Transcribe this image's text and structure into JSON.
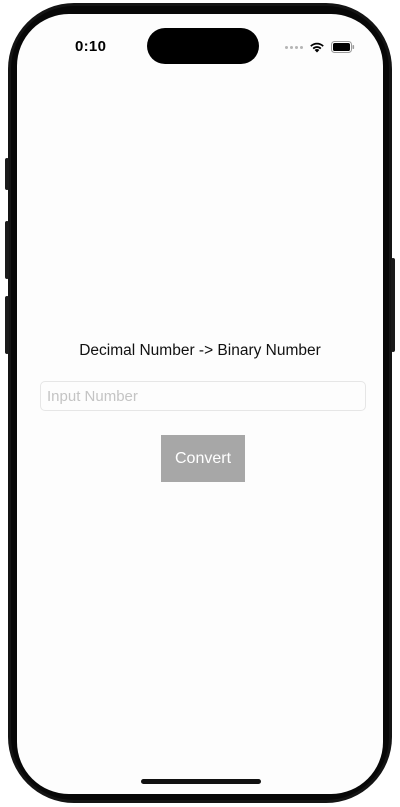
{
  "status_bar": {
    "time": "0:10",
    "icons": [
      "signal-dots-icon",
      "wifi-icon",
      "battery-icon"
    ]
  },
  "main": {
    "title": "Decimal Number -> Binary Number",
    "input": {
      "value": "",
      "placeholder": "Input Number"
    },
    "convert_button_label": "Convert"
  },
  "colors": {
    "button_background": "#a7a7a7",
    "button_text": "#ffffff",
    "placeholder": "#c4c4c4",
    "screen_background": "#fdfdfd",
    "frame": "#141414"
  }
}
